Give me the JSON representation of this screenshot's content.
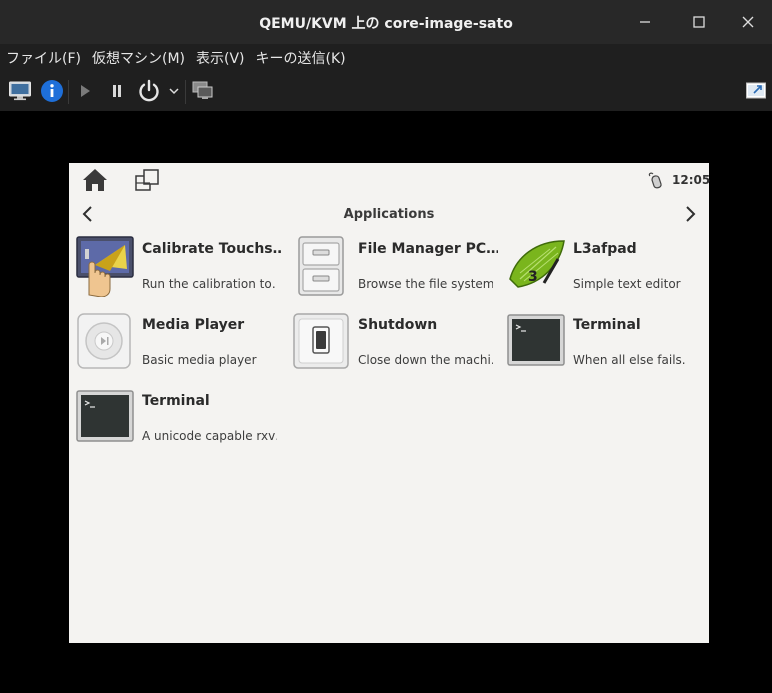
{
  "window": {
    "title": "QEMU/KVM 上の core-image-sato"
  },
  "menubar": {
    "items": [
      {
        "label": "ファイル(F)"
      },
      {
        "label": "仮想マシン(M)"
      },
      {
        "label": "表示(V)"
      },
      {
        "label": "キーの送信(K)"
      }
    ]
  },
  "toolbar": {
    "icons": [
      "monitor-icon",
      "info-icon",
      "play-icon",
      "pause-icon",
      "power-icon",
      "chevron-down-icon",
      "snapshots-icon",
      "fullscreen-icon"
    ]
  },
  "guest": {
    "clock": "12:05",
    "section_title": "Applications",
    "apps": [
      {
        "name": "Calibrate Touchs…",
        "desc": "Run the calibration to…",
        "icon": "calibrate-icon"
      },
      {
        "name": "File Manager PC…",
        "desc": "Browse the file system…",
        "icon": "file-cabinet-icon"
      },
      {
        "name": "L3afpad",
        "desc": "Simple text editor",
        "icon": "leafpad-icon"
      },
      {
        "name": "Media Player",
        "desc": "Basic media player",
        "icon": "media-player-icon"
      },
      {
        "name": "Shutdown",
        "desc": "Close down the machi…",
        "icon": "shutdown-icon"
      },
      {
        "name": "Terminal",
        "desc": "When all else fails.",
        "icon": "terminal-icon"
      },
      {
        "name": "Terminal",
        "desc": "A unicode capable rxv…",
        "icon": "terminal-icon"
      }
    ]
  },
  "colors": {
    "titlebar_bg": "#282828",
    "menubar_bg": "#1f1f1f",
    "vm_bg": "#000000",
    "guest_bg": "#f4f3f1",
    "info_blue": "#1e6fd9",
    "leaf_green": "#7ab51d"
  }
}
